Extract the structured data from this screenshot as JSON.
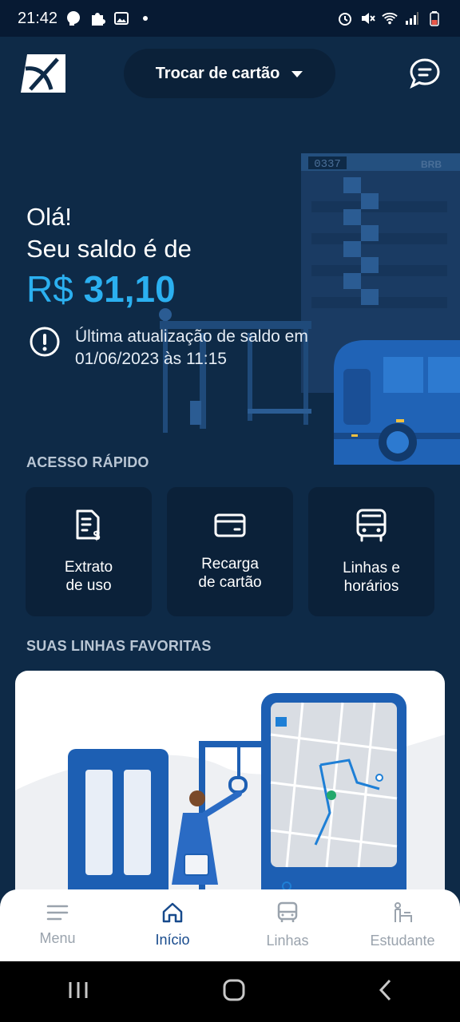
{
  "status_bar": {
    "time": "21:42",
    "left_icons": [
      "chat-bubble-icon",
      "puzzle-icon",
      "image-icon",
      "dot-icon"
    ],
    "right_icons": [
      "alarm-icon",
      "mute-icon",
      "wifi-icon",
      "signal-icon",
      "battery-icon"
    ],
    "battery_color": "#e8584a"
  },
  "header": {
    "card_switch_label": "Trocar de cartão",
    "logo_icon": "brand-logo",
    "chat_icon": "chat-support-icon"
  },
  "hero": {
    "greeting": "Olá!",
    "balance_label": "Seu saldo é de",
    "currency": "R$",
    "balance_value": "31,10",
    "update_text": "Última atualização de saldo em 01/06/2023 às 11:15",
    "bus_display_text": "0337",
    "building_brand": "BRB"
  },
  "quick_access": {
    "title": "ACESSO RÁPIDO",
    "items": [
      {
        "line1": "Extrato",
        "line2": "de uso",
        "icon": "statement-icon"
      },
      {
        "line1": "Recarga",
        "line2": "de cartão",
        "icon": "card-icon"
      },
      {
        "line1": "Linhas e",
        "line2": "horários",
        "icon": "bus-icon"
      }
    ]
  },
  "favorites": {
    "title": "SUAS LINHAS FAVORITAS"
  },
  "bottom_nav": {
    "items": [
      {
        "label": "Menu",
        "icon": "menu-icon"
      },
      {
        "label": "Início",
        "icon": "home-icon"
      },
      {
        "label": "Linhas",
        "icon": "bus-icon"
      },
      {
        "label": "Estudante",
        "icon": "student-icon"
      }
    ],
    "active": "Início"
  },
  "colors": {
    "background": "#0e2a47",
    "card": "#0b2139",
    "accent": "#2bb0f0",
    "active_nav": "#174a8c",
    "inactive_nav": "#9aa3ad"
  }
}
